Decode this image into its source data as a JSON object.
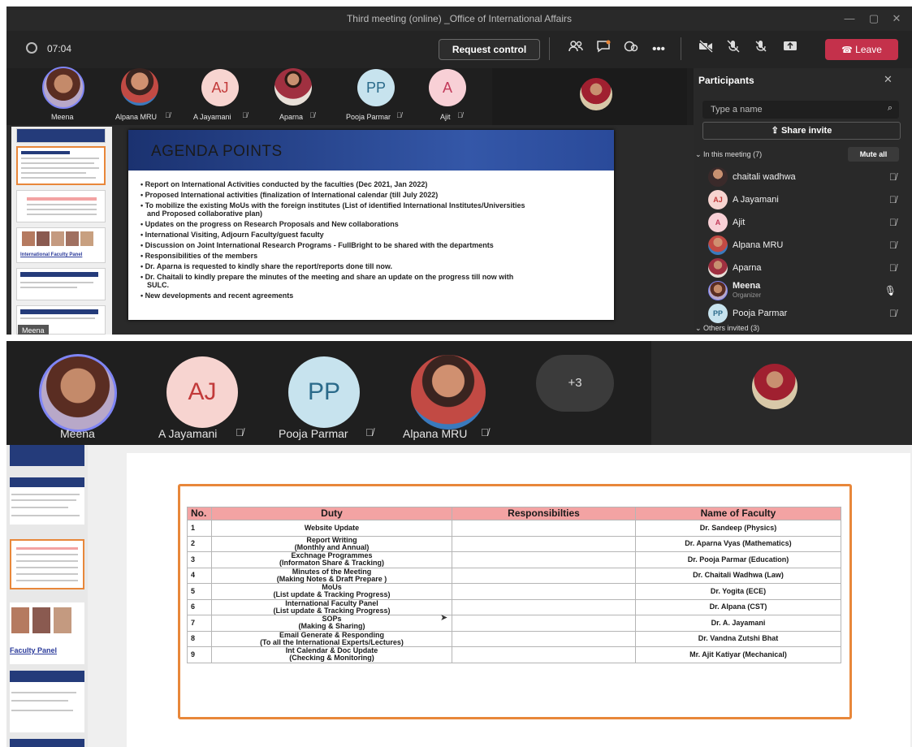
{
  "screen1": {
    "window_title": "Third meeting (online) _Office of International Affairs",
    "timer": "07:04",
    "request_control_label": "Request control",
    "leave_label": "Leave",
    "participants_strip": [
      {
        "name": "Meena",
        "initials": ""
      },
      {
        "name": "Alpana MRU",
        "initials": ""
      },
      {
        "name": "A Jayamani",
        "initials": "AJ"
      },
      {
        "name": "Aparna",
        "initials": ""
      },
      {
        "name": "Pooja Parmar",
        "initials": "PP"
      },
      {
        "name": "Ajit",
        "initials": "A"
      }
    ],
    "presenter_tag": "Meena",
    "slide_title": "AGENDA POINTS",
    "agenda": [
      "Report on International Activities conducted by the  faculties (Dec 2021, Jan 2022)",
      "Proposed International activities (finalization of International calendar (till July 2022)",
      "To mobilize the existing MoUs with the foreign institutes (List of identified  International Institutes/Universities",
      "and Proposed collaborative plan)",
      "Updates on the progress on Research Proposals and New collaborations",
      "International Visiting, Adjourn Faculty/guest faculty",
      "Discussion on Joint International Research Programs - FullBright to be shared with the departments",
      "Responsibilities of the members",
      "Dr. Aparna is requested to kindly share the report/reports done till now.",
      "Dr. Chaitali to kindly prepare the minutes of the meeting and share an update on the progress till now with",
      "SULC.",
      "New developments and recent agreements"
    ],
    "thumb_label": "International Faculty Panel",
    "panel": {
      "title": "Participants",
      "search_placeholder": "Type a name",
      "share_invite": "Share invite",
      "in_meeting": "In this meeting (7)",
      "mute_all": "Mute all",
      "others_invited": "Others invited (3)",
      "people": [
        {
          "name": "chaitali wadhwa",
          "initials": "",
          "role": ""
        },
        {
          "name": "A Jayamani",
          "initials": "AJ",
          "role": ""
        },
        {
          "name": "Ajit",
          "initials": "A",
          "role": ""
        },
        {
          "name": "Alpana MRU",
          "initials": "",
          "role": ""
        },
        {
          "name": "Aparna",
          "initials": "",
          "role": ""
        },
        {
          "name": "Meena",
          "initials": "",
          "role": "Organizer"
        },
        {
          "name": "Pooja Parmar",
          "initials": "PP",
          "role": ""
        }
      ]
    }
  },
  "screen2": {
    "participants_strip": [
      {
        "name": "Meena",
        "initials": ""
      },
      {
        "name": "A Jayamani",
        "initials": "AJ"
      },
      {
        "name": "Pooja Parmar",
        "initials": "PP"
      },
      {
        "name": "Alpana MRU",
        "initials": ""
      }
    ],
    "overflow_count": "+3",
    "thumb_label": "Faculty Panel",
    "table": {
      "headers": [
        "No.",
        "Duty",
        "Responsibilties",
        "Name of Faculty"
      ],
      "rows": [
        {
          "no": "1",
          "duty": "Website Update",
          "duty2": "",
          "resp": "",
          "faculty": "Dr. Sandeep (Physics)"
        },
        {
          "no": "2",
          "duty": "Report Writing",
          "duty2": "(Monthly and Annual)",
          "resp": "",
          "faculty": "Dr. Aparna Vyas (Mathematics)"
        },
        {
          "no": "3",
          "duty": "Exchnage Programmes",
          "duty2": "(Informaton Share & Tracking)",
          "resp": "",
          "faculty": "Dr. Pooja Parmar (Education)"
        },
        {
          "no": "4",
          "duty": "Minutes of the Meeting",
          "duty2": "(Making Notes & Draft Prepare )",
          "resp": "",
          "faculty": "Dr. Chaitali Wadhwa (Law)"
        },
        {
          "no": "5",
          "duty": "MoUs",
          "duty2": "(List update & Tracking Progress)",
          "resp": "",
          "faculty": "Dr. Yogita (ECE)"
        },
        {
          "no": "6",
          "duty": "International Faculty Panel",
          "duty2": "(List update & Tracking Progress)",
          "resp": "",
          "faculty": "Dr. Alpana (CST)"
        },
        {
          "no": "7",
          "duty": "SOPs",
          "duty2": "(Making & Sharing)",
          "resp": "",
          "faculty": "Dr. A. Jayamani"
        },
        {
          "no": "8",
          "duty": "Email Generate & Responding",
          "duty2": "(To all the International Experts/Lectures)",
          "resp": "",
          "faculty": "Dr. Vandna Zutshi Bhat"
        },
        {
          "no": "9",
          "duty": "Int Calendar & Doc Update",
          "duty2": "(Checking & Monitoring)",
          "resp": "",
          "faculty": "Mr. Ajit Katiyar (Mechanical)"
        }
      ]
    }
  },
  "colors": {
    "leave": "#c4314b",
    "table_header": "#f3a3a3",
    "slide_border": "#e8873a",
    "initials_bg_aj": "#f7d4d0",
    "initials_bg_pp": "#c7e3ee",
    "initials_bg_a": "#f8d0d6"
  }
}
